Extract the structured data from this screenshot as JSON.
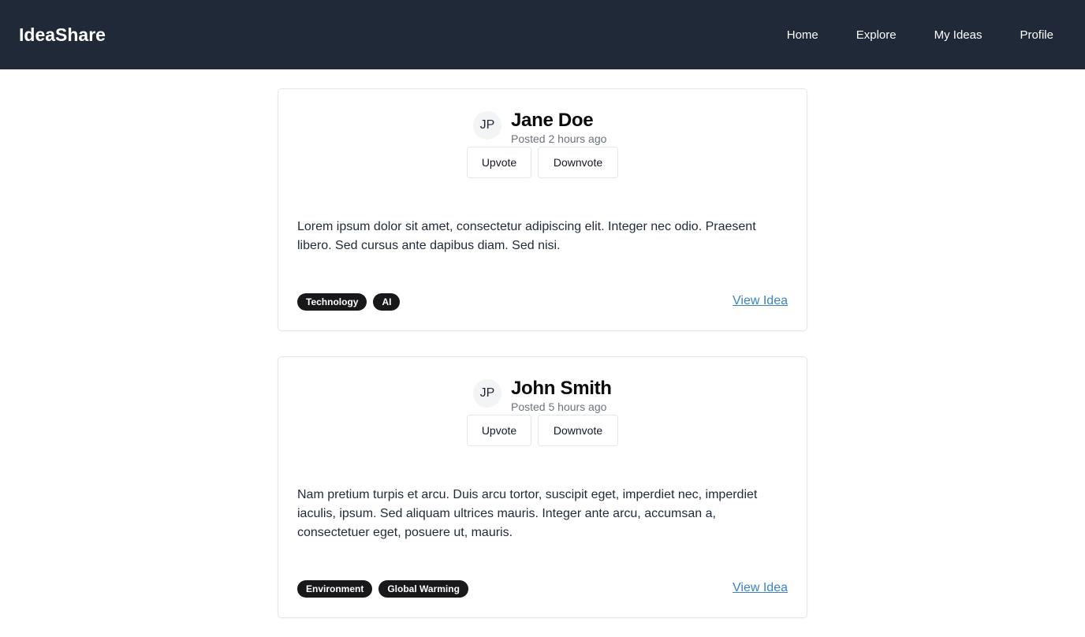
{
  "header": {
    "brand": "IdeaShare",
    "nav": [
      "Home",
      "Explore",
      "My Ideas",
      "Profile"
    ]
  },
  "ideas": [
    {
      "avatar_initials": "JP",
      "author": "Jane Doe",
      "posted": "Posted 2 hours ago",
      "upvote_label": "Upvote",
      "downvote_label": "Downvote",
      "body": "Lorem ipsum dolor sit amet, consectetur adipiscing elit. Integer nec odio. Praesent libero. Sed cursus ante dapibus diam. Sed nisi.",
      "tags": [
        "Technology",
        "AI"
      ],
      "link_label": "View Idea"
    },
    {
      "avatar_initials": "JP",
      "author": "John Smith",
      "posted": "Posted 5 hours ago",
      "upvote_label": "Upvote",
      "downvote_label": "Downvote",
      "body": "Nam pretium turpis et arcu. Duis arcu tortor, suscipit eget, imperdiet nec, imperdiet iaculis, ipsum. Sed aliquam ultrices mauris. Integer ante arcu, accumsan a, consectetuer eget, posuere ut, mauris.",
      "tags": [
        "Environment",
        "Global Warming"
      ],
      "link_label": "View Idea"
    }
  ],
  "colors": {
    "header_bg": "#1f2937",
    "tag_bg": "#18181b",
    "link": "#3b82c4"
  }
}
